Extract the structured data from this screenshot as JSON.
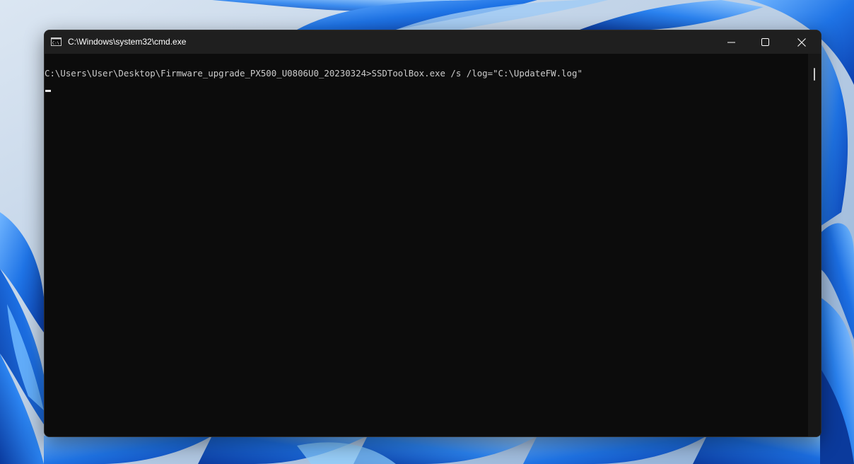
{
  "window": {
    "title": "C:\\Windows\\system32\\cmd.exe",
    "icons": {
      "app": "cmd-app-icon",
      "minimize": "minimize-icon",
      "maximize": "maximize-icon",
      "close": "close-icon"
    }
  },
  "terminal": {
    "lines": [
      "C:\\Users\\User\\Desktop\\Firmware_upgrade_PX500_U0806U0_20230324>SSDToolBox.exe /s /log=\"C:\\UpdateFW.log\""
    ]
  },
  "colors": {
    "terminal_background": "#0c0c0c",
    "terminal_text": "#cccccc",
    "titlebar": "#1f1f1f",
    "wallpaper_accent": "#1a6fe0"
  }
}
